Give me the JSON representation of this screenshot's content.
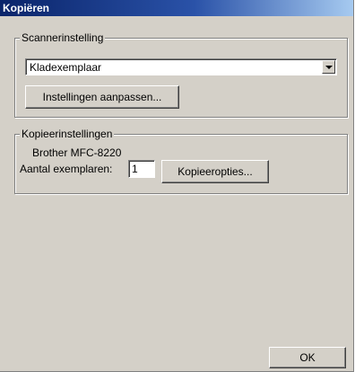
{
  "window": {
    "title": "Kopiëren"
  },
  "scanner_group": {
    "legend": "Scannerinstelling",
    "dropdown_value": "Kladexemplaar",
    "adjust_button": "Instellingen aanpassen..."
  },
  "copy_group": {
    "legend": "Kopieerinstellingen",
    "printer_name": "Brother MFC-8220",
    "copies_label": "Aantal exemplaren:",
    "copies_value": "1",
    "options_button": "Kopieeropties..."
  },
  "footer": {
    "ok_button": "OK"
  }
}
